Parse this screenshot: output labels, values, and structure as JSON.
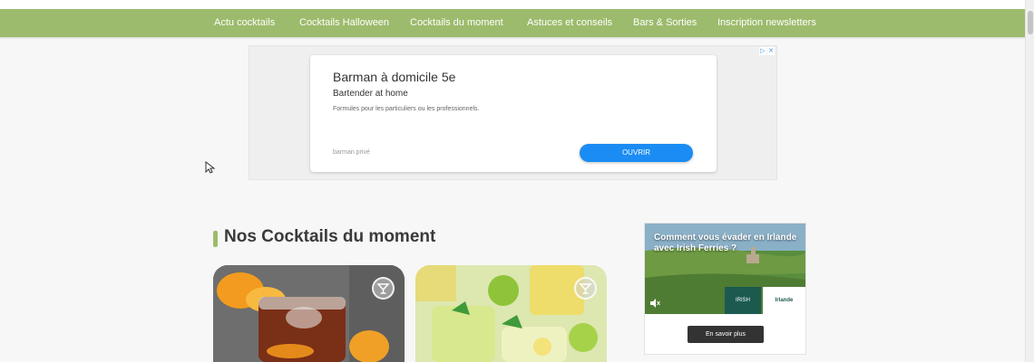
{
  "nav": {
    "items": [
      {
        "label": "Actu cocktails"
      },
      {
        "label": "Cocktails Halloween"
      },
      {
        "label": "Cocktails du moment"
      },
      {
        "label": "Astuces et conseils"
      },
      {
        "label": "Bars & Sorties"
      },
      {
        "label": "Inscription newsletters"
      }
    ]
  },
  "ad": {
    "title": "Barman à domicile 5e",
    "subtitle": "Bartender at home",
    "description": "Formules pour les particuliers ou les professionnels.",
    "source": "barman privé",
    "cta": "OUVRIR",
    "cta_color": "#1a8cf3"
  },
  "section": {
    "title": "Nos Cocktails du moment",
    "accent_color": "#9cbb6c"
  },
  "cards": [
    {
      "icon": "cocktail-glass-icon"
    },
    {
      "icon": "cocktail-glass-icon"
    }
  ],
  "side_ad": {
    "headline": "Comment vous évader en Irlande avec Irish Ferries ?",
    "logo_left": "IRISH FERRIES",
    "logo_right": "Irlande",
    "cta": "En savoir plus"
  }
}
